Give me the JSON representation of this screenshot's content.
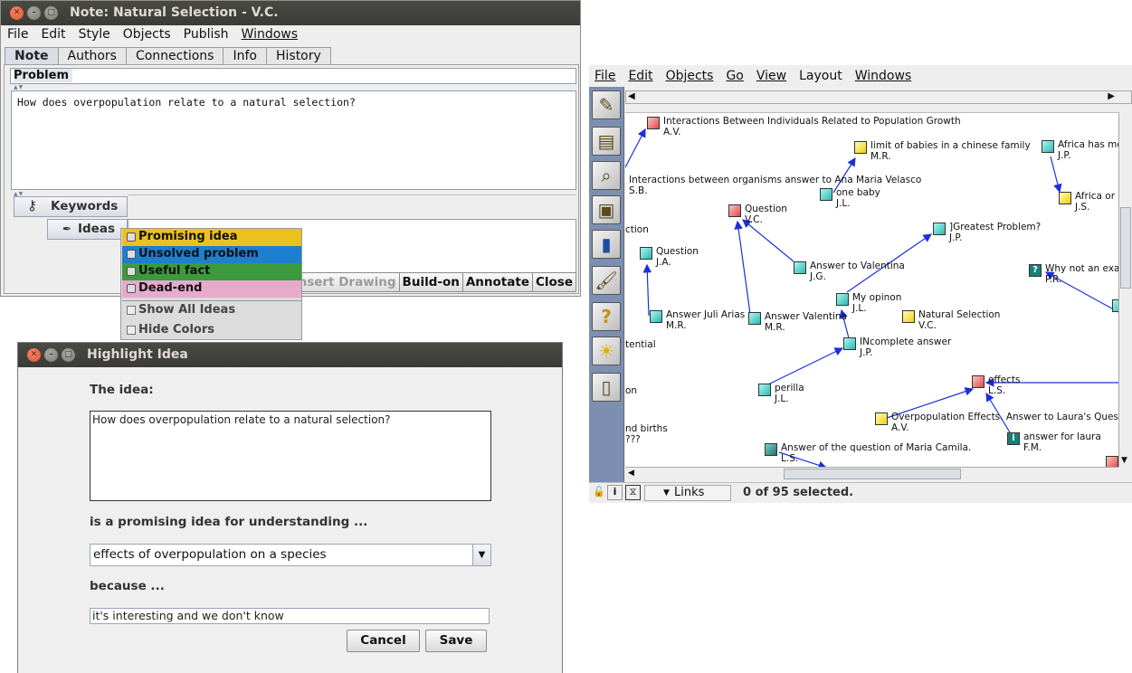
{
  "note_window": {
    "title": "Note: Natural Selection - V.C.",
    "menu": [
      "File",
      "Edit",
      "Style",
      "Objects",
      "Publish",
      "Windows"
    ],
    "tabs": [
      "Note",
      "Authors",
      "Connections",
      "Info",
      "History"
    ],
    "problem_label": "Problem",
    "note_text": "How does overpopulation relate to a natural selection?",
    "keywords_label": "Keywords",
    "ideas_label": "Ideas",
    "buttons": [
      "Insert Drawing",
      "Build-on",
      "Annotate",
      "Close"
    ]
  },
  "color_popup": {
    "items": [
      {
        "label": "Promising idea",
        "color": "#e9c21f"
      },
      {
        "label": "Unsolved problem",
        "color": "#1d7fd0"
      },
      {
        "label": "Useful fact",
        "color": "#3c9a3c"
      },
      {
        "label": "Dead-end",
        "color": "#e6aacd"
      }
    ],
    "show_all": "Show All Ideas",
    "hide_colors": "Hide Colors"
  },
  "highlight_dialog": {
    "title": "Highlight Idea",
    "idea_label": "The idea:",
    "idea_text": "How does overpopulation relate to a natural selection?",
    "promising_label": "is a promising idea for understanding ...",
    "selected_option": "effects of overpopulation on a species",
    "because_label": "because ...",
    "because_text": "it's interesting and we don't know",
    "cancel": "Cancel",
    "save": "Save"
  },
  "map_window": {
    "menu": [
      "File",
      "Edit",
      "Objects",
      "Go",
      "View",
      "Layout",
      "Windows"
    ],
    "links_label": "Links",
    "selection_status": "0 of 95 selected.",
    "nodes": [
      {
        "title": "Interactions Between Individuals Related to Population Growth",
        "author": "A.V.",
        "type": "red"
      },
      {
        "title": "limit of babies in a chinese family",
        "author": "M.R.",
        "type": "bulb"
      },
      {
        "title": "Africa has mo",
        "author": "J.P.",
        "type": "cyan"
      },
      {
        "title": "Interactions between organisms answer to Ana Maria Velasco",
        "author": "S.B.",
        "type": "none"
      },
      {
        "title": "one baby",
        "author": "J.L.",
        "type": "cyan"
      },
      {
        "title": "Africa or S",
        "author": "J.S.",
        "type": "bulb"
      },
      {
        "title": "Question",
        "author": "V.C.",
        "type": "red"
      },
      {
        "title": "]Greatest Problem?",
        "author": "J.P.",
        "type": "cyan"
      },
      {
        "title": "ction",
        "author": "",
        "type": "none"
      },
      {
        "title": "Question",
        "author": "J.A.",
        "type": "cyan"
      },
      {
        "title": "Answer to Valentina",
        "author": "J.G.",
        "type": "cyan"
      },
      {
        "title": "Why not an exa",
        "author": "P.R.",
        "type": "q"
      },
      {
        "title": "My opinon",
        "author": "J.L.",
        "type": "cyan"
      },
      {
        "title": "Answer Juli Arias",
        "author": "M.R.",
        "type": "cyan"
      },
      {
        "title": "Answer Valentina",
        "author": "M.R.",
        "type": "cyan"
      },
      {
        "title": "Natural Selection",
        "author": "V.C.",
        "type": "bulb"
      },
      {
        "title": "tential",
        "author": "",
        "type": "none"
      },
      {
        "title": "INcomplete answer",
        "author": "J.P.",
        "type": "cyan"
      },
      {
        "title": "effects",
        "author": "L.S.",
        "type": "red"
      },
      {
        "title": "perilla",
        "author": "J.L.",
        "type": "cyan"
      },
      {
        "title": "on",
        "author": "",
        "type": "none"
      },
      {
        "title": "Overpopulation Effects. Answer to Laura's Question",
        "author": "A.V.",
        "type": "bulb"
      },
      {
        "title": "nd births",
        "author": "???",
        "type": "none"
      },
      {
        "title": "answer for laura",
        "author": "F.M.",
        "type": "q"
      },
      {
        "title": "Answer of the question of Maria Camila.",
        "author": "L.S.",
        "type": "dark"
      }
    ]
  }
}
